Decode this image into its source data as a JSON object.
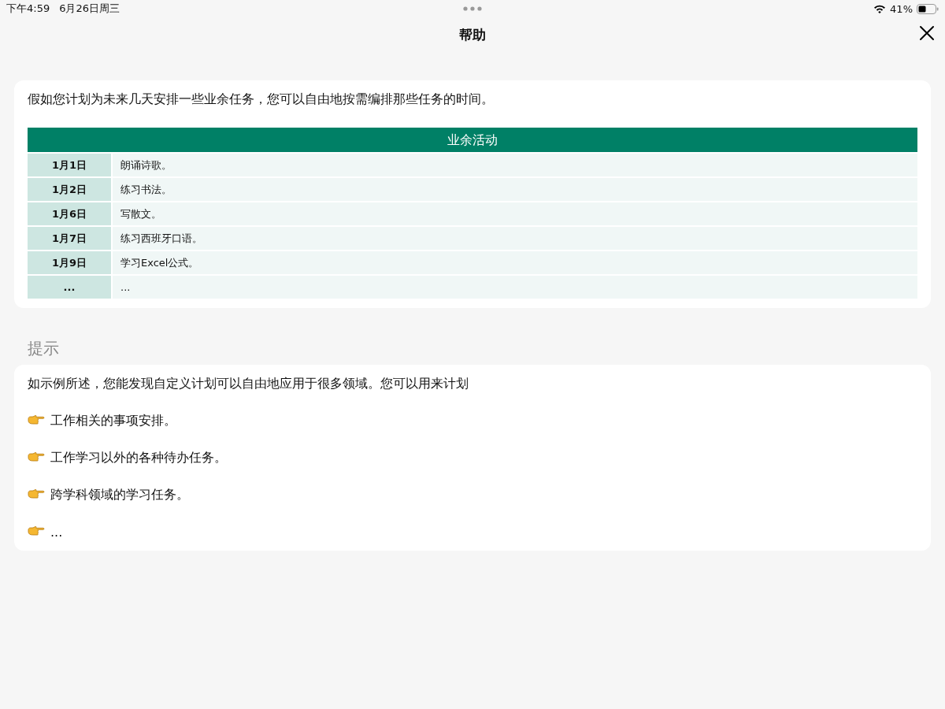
{
  "status_bar": {
    "time": "下午4:59",
    "date": "6月26日周三",
    "battery": "41%"
  },
  "header": {
    "title": "帮助"
  },
  "intro": {
    "text": "假如您计划为未来几天安排一些业余任务，您可以自由地按需编排那些任务的时间。",
    "table": {
      "title": "业余活动",
      "rows": [
        {
          "date": "1月1日",
          "task": "朗诵诗歌。"
        },
        {
          "date": "1月2日",
          "task": "练习书法。"
        },
        {
          "date": "1月6日",
          "task": "写散文。"
        },
        {
          "date": "1月7日",
          "task": "练习西班牙口语。"
        },
        {
          "date": "1月9日",
          "task": "学习Excel公式。"
        },
        {
          "date": "...",
          "task": "..."
        }
      ]
    }
  },
  "tips": {
    "heading": "提示",
    "text": "如示例所述，您能发现自定义计划可以自由地应用于很多领域。您可以用来计划",
    "items": [
      "工作相关的事项安排。",
      "工作学习以外的各种待办任务。",
      "跨学科领域的学习任务。",
      "..."
    ]
  }
}
